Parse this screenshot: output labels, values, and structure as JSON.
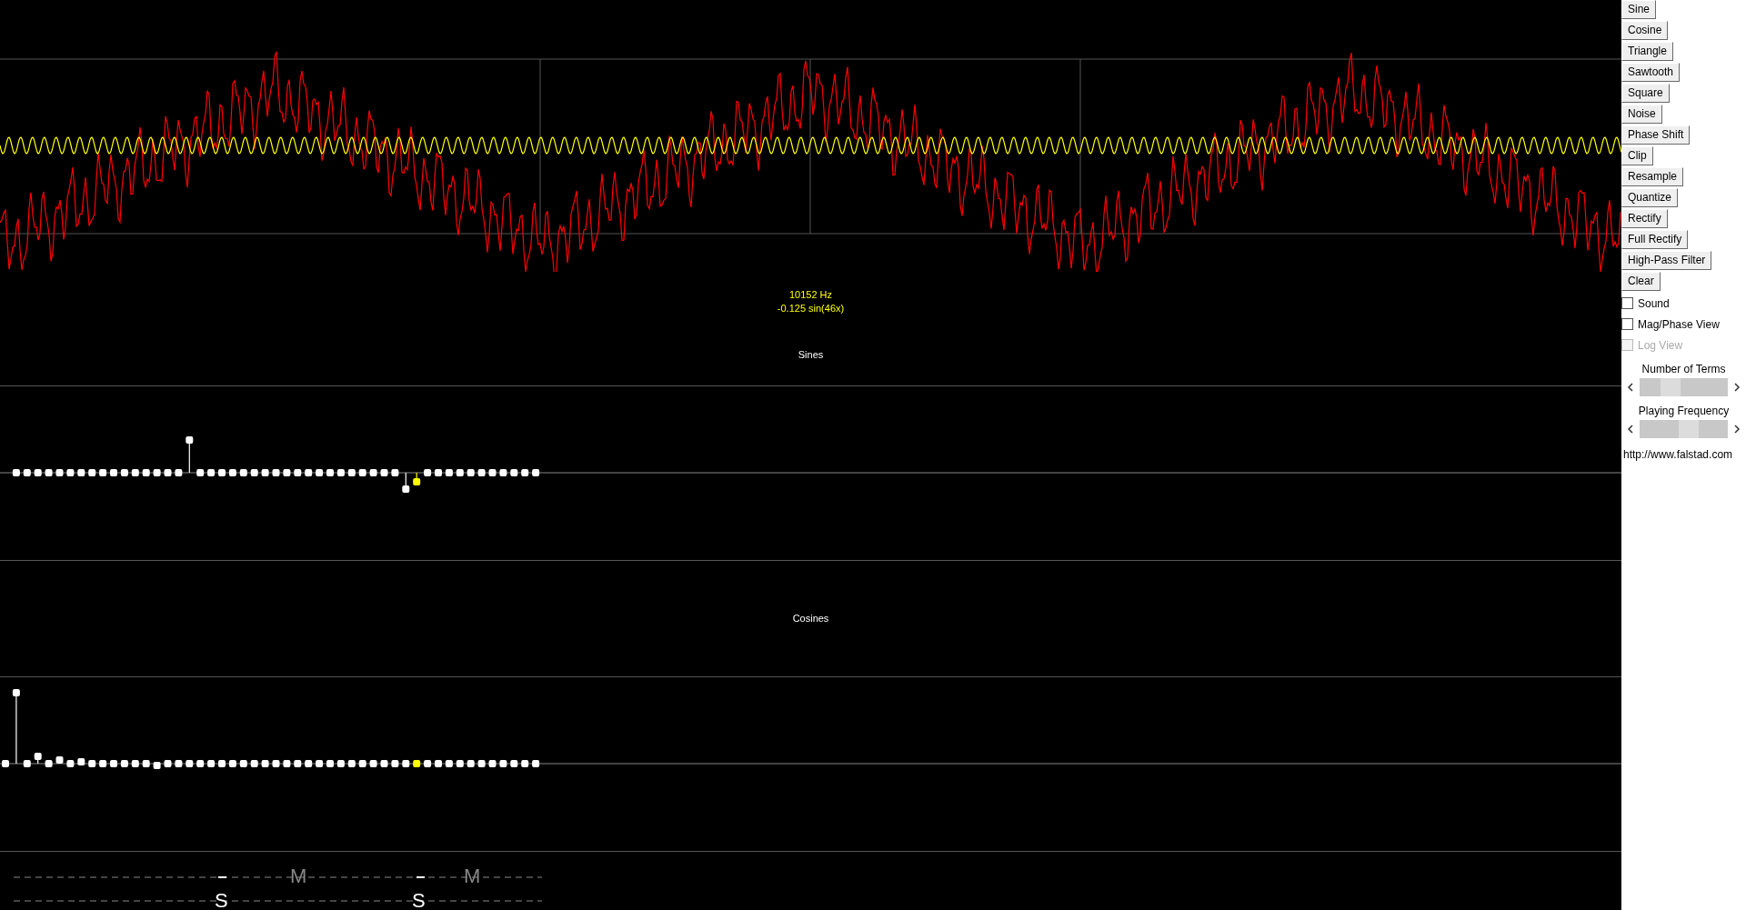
{
  "readout": {
    "frequency": "10152 Hz",
    "term": "-0.125 sin(46x)"
  },
  "sections": [
    {
      "label": "Sines"
    },
    {
      "label": "Cosines"
    }
  ],
  "markers": {
    "top": [
      "M",
      "M"
    ],
    "bottom": [
      "S",
      "S"
    ]
  },
  "buttons": [
    "Sine",
    "Cosine",
    "Triangle",
    "Sawtooth",
    "Square",
    "Noise",
    "Phase Shift",
    "Clip",
    "Resample",
    "Quantize",
    "Rectify",
    "Full Rectify",
    "High-Pass Filter",
    "Clear"
  ],
  "checkboxes": [
    {
      "label": "Sound",
      "checked": false,
      "disabled": false
    },
    {
      "label": "Mag/Phase View",
      "checked": false,
      "disabled": false
    },
    {
      "label": "Log View",
      "checked": false,
      "disabled": true
    }
  ],
  "scrollbars": [
    {
      "label": "Number of Terms",
      "level": 0.35
    },
    {
      "label": "Playing Frequency",
      "level": 0.56
    }
  ],
  "link": "http://www.falstad.com"
}
